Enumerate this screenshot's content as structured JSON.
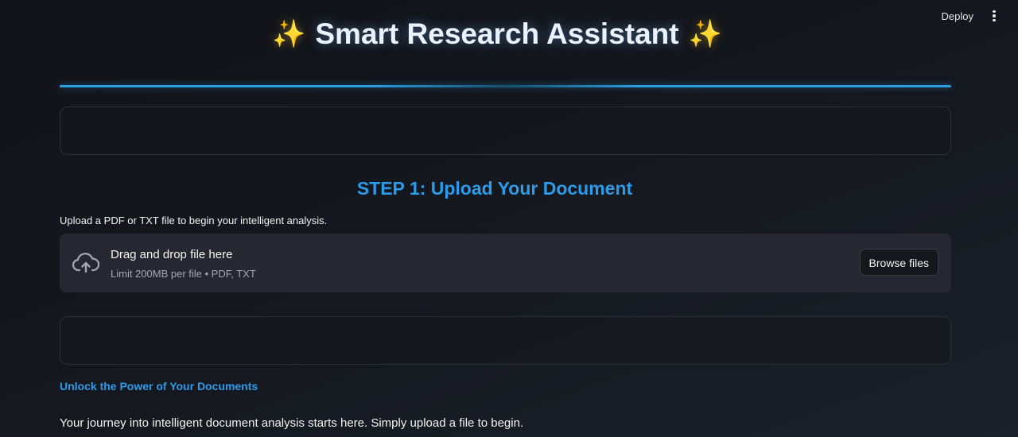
{
  "topbar": {
    "deploy_label": "Deploy",
    "menu_icon": "kebab-menu-icon"
  },
  "header": {
    "sparkle_left": "✨",
    "title": "Smart Research Assistant",
    "sparkle_right": "✨"
  },
  "step": {
    "heading": "STEP 1: Upload Your Document",
    "instruction": "Upload a PDF or TXT file to begin your intelligent analysis."
  },
  "uploader": {
    "icon": "cloud-upload-icon",
    "title": "Drag and drop file here",
    "subtitle": "Limit 200MB per file • PDF, TXT",
    "browse_label": "Browse files"
  },
  "info": {
    "link_text": "Unlock the Power of Your Documents",
    "body": "Your journey into intelligent document analysis starts here. Simply upload a file to begin."
  },
  "colors": {
    "accent": "#2b9bea",
    "background": "#14171d",
    "dropzone": "#262730",
    "sparkle": "#f7c531"
  }
}
